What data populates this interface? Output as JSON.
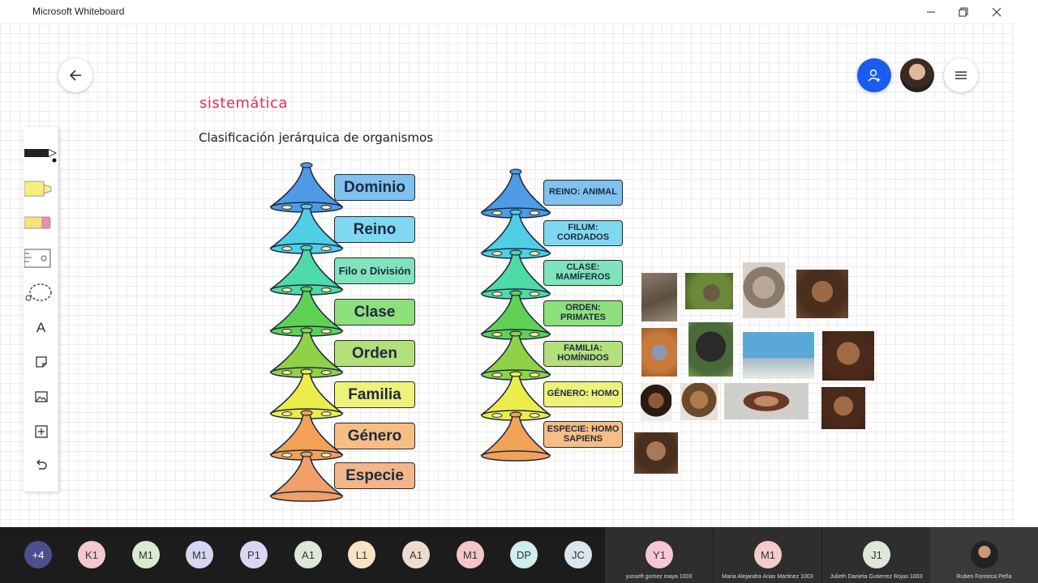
{
  "window": {
    "title": "Microsoft Whiteboard"
  },
  "canvas": {
    "heading": "sistemática",
    "subheading": "Clasificación jerárquica de organismos"
  },
  "pyramid_generic": {
    "labels": [
      {
        "text": "Dominio",
        "color": "#7fc2ef"
      },
      {
        "text": "Reino",
        "color": "#7fd8ef"
      },
      {
        "text": "Filo o División",
        "color": "#7fe3bb"
      },
      {
        "text": "Clase",
        "color": "#8de07c"
      },
      {
        "text": "Orden",
        "color": "#b3e07a"
      },
      {
        "text": "Familia",
        "color": "#eef17a"
      },
      {
        "text": "Género",
        "color": "#f6be82"
      },
      {
        "text": "Especie",
        "color": "#f3b68a"
      }
    ]
  },
  "pyramid_human": {
    "labels": [
      {
        "text": "REINO: ANIMAL",
        "color": "#7fc2ef"
      },
      {
        "text": "FILUM: CORDADOS",
        "color": "#7fd8ef"
      },
      {
        "text": "CLASE: MAMÍFEROS",
        "color": "#7fe3bb"
      },
      {
        "text": "ORDEN: PRIMATES",
        "color": "#8de07c"
      },
      {
        "text": "FAMILIA: HOMÍNIDOS",
        "color": "#b3e07a"
      },
      {
        "text": "GÉNERO: HOMO",
        "color": "#eef17a"
      },
      {
        "text": "ESPECIE: HOMO SAPIENS",
        "color": "#f6be82"
      }
    ]
  },
  "participants": [
    {
      "initials": "+4",
      "color": "#4b4f8c"
    },
    {
      "initials": "K1",
      "color": "#f3c8d0"
    },
    {
      "initials": "M1",
      "color": "#d9ebd0"
    },
    {
      "initials": "M1",
      "color": "#d6d6f2"
    },
    {
      "initials": "P1",
      "color": "#dcd6f2"
    },
    {
      "initials": "A1",
      "color": "#dfe8d8"
    },
    {
      "initials": "L1",
      "color": "#f6e4c4"
    },
    {
      "initials": "A1",
      "color": "#ecdccf"
    },
    {
      "initials": "M1",
      "color": "#f3c7c7"
    },
    {
      "initials": "DP",
      "color": "#cfeef0"
    },
    {
      "initials": "JC",
      "color": "#d9e6f0"
    }
  ],
  "video_tiles": [
    {
      "initials": "Y1",
      "name": "yusseft gomez maya 1003",
      "color": "#f6c7d5"
    },
    {
      "initials": "M1",
      "name": "Maria Alejandra Arias Martinez 1003",
      "color": "#f3cccc"
    },
    {
      "initials": "J1",
      "name": "Julieth Daniela Gutierrez Rojas 1003",
      "color": "#dfe8d8"
    },
    {
      "initials": "",
      "name": "Ruben Fonseca Peña",
      "color": "#2a2a2a"
    }
  ]
}
